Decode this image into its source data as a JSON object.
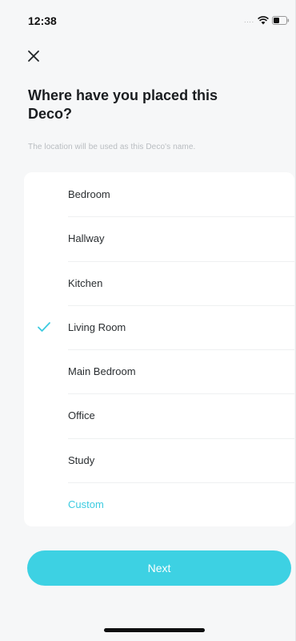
{
  "status_bar": {
    "time": "12:38",
    "signal": "....",
    "icons": [
      "wifi-icon",
      "battery-icon"
    ]
  },
  "header": {
    "close_icon": "close-icon",
    "title": "Where have you placed this Deco?",
    "subtitle": "The location will be used as this Deco's name."
  },
  "locations": {
    "items": [
      {
        "label": "Bedroom",
        "selected": false
      },
      {
        "label": "Hallway",
        "selected": false
      },
      {
        "label": "Kitchen",
        "selected": false
      },
      {
        "label": "Living Room",
        "selected": true
      },
      {
        "label": "Main Bedroom",
        "selected": false
      },
      {
        "label": "Office",
        "selected": false
      },
      {
        "label": "Study",
        "selected": false
      },
      {
        "label": "Custom",
        "selected": false
      }
    ]
  },
  "footer": {
    "next_label": "Next"
  },
  "colors": {
    "accent": "#3dd1e3",
    "accent_text": "#3ccbe0",
    "background": "#f6f7f8",
    "card": "#ffffff"
  }
}
